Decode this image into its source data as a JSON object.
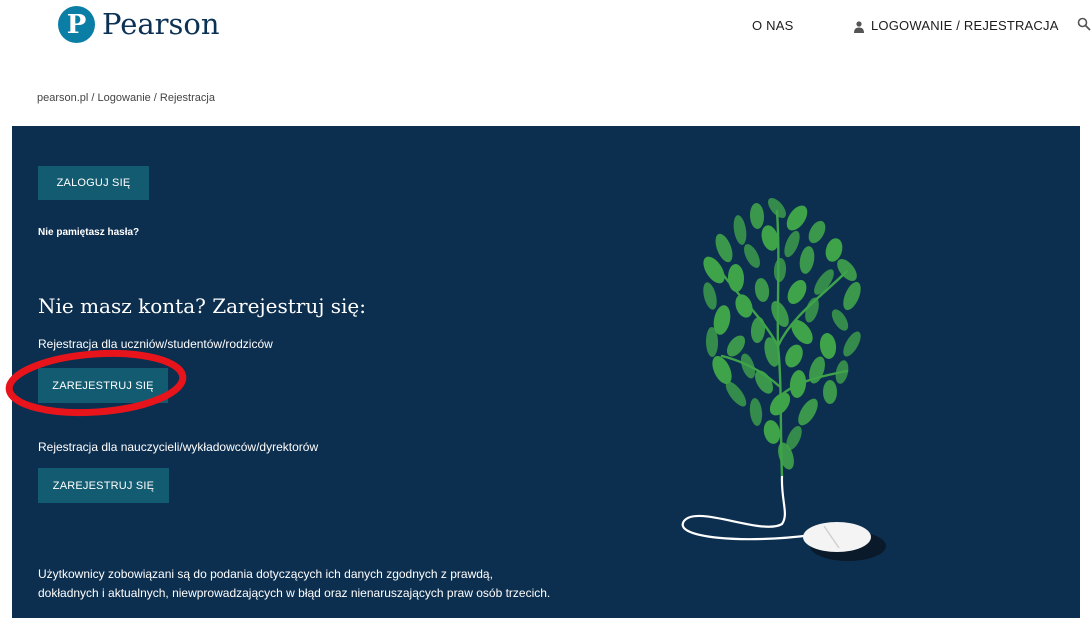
{
  "header": {
    "logo_text": "Pearson",
    "logo_mark": "P",
    "nav": {
      "about": "O NAS",
      "login": "LOGOWANIE / REJESTRACJA"
    },
    "icons": {
      "user": "user-icon",
      "search": "search-icon"
    },
    "breadcrumb": "pearson.pl / Logowanie / Rejestracja"
  },
  "main": {
    "login_button": "ZALOGUJ SIĘ",
    "forgot_password": "Nie pamiętasz hasła?",
    "register_heading": "Nie masz konta? Zarejestruj się:",
    "students_label": "Rejestracja dla uczniów/studentów/rodziców",
    "students_button": "ZAREJESTRUJ SIĘ",
    "teachers_label": "Rejestracja dla nauczycieli/wykładowców/dyrektorów",
    "teachers_button": "ZAREJESTRUJ SIĘ",
    "disclaimer_line1": "Użytkownicy zobowiązani są do podania dotyczących ich danych zgodnych z prawdą,",
    "disclaimer_line2": "dokładnych i aktualnych, niewprowadzających w błąd oraz nienaruszających praw osób trzecich."
  },
  "colors": {
    "brand": "#0a7ea4",
    "panel_background": "#0d2f4f",
    "button": "#135b70",
    "annotation": "#e8141b",
    "leaf": "#3fa34a"
  },
  "illustration": {
    "icon": "tree-mouse-icon"
  }
}
